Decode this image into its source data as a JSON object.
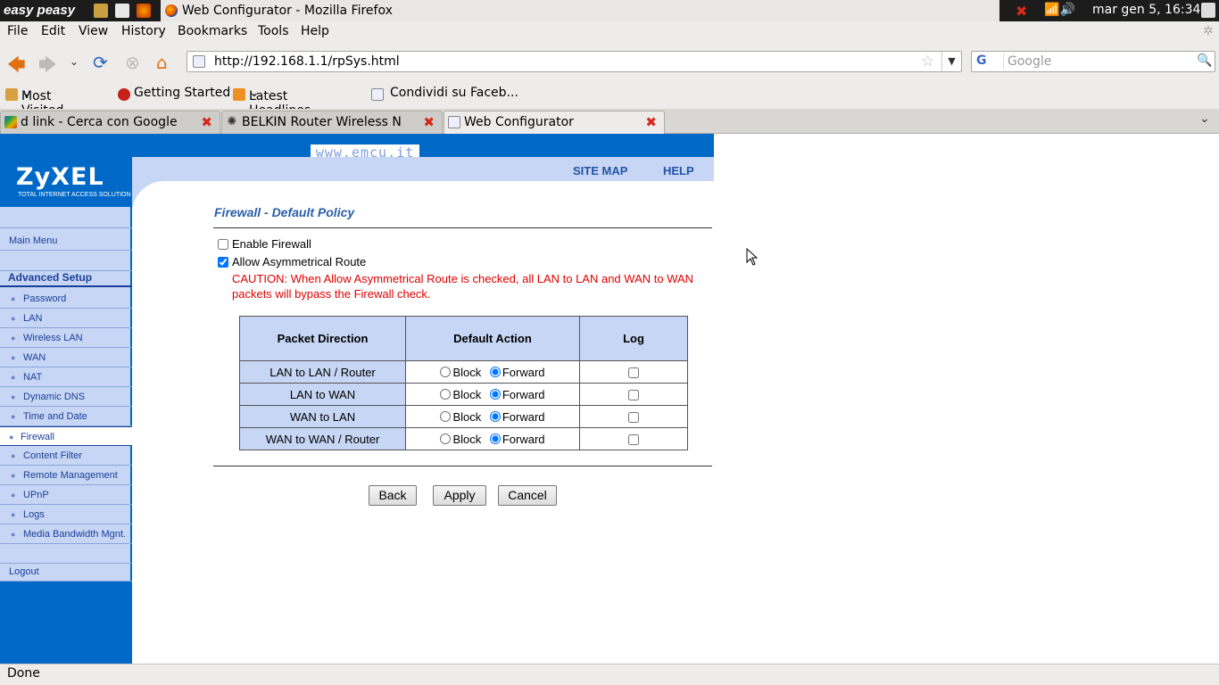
{
  "panel": {
    "logo": "easy peasy",
    "window_title": "Web Configurator - Mozilla Firefox",
    "clock": "mar gen  5, 16:34"
  },
  "menubar": [
    "File",
    "Edit",
    "View",
    "History",
    "Bookmarks",
    "Tools",
    "Help"
  ],
  "nav": {
    "url": "http://192.168.1.1/rpSys.html",
    "search_placeholder": "Google",
    "search_engine": "G"
  },
  "bookmarks": [
    "Most Visited",
    "Getting Started",
    "Latest Headlines",
    "Condividi su Faceb..."
  ],
  "tabs": [
    {
      "label": "d link - Cerca con Google"
    },
    {
      "label": "BELKIN Router Wireless N"
    },
    {
      "label": "Web Configurator"
    }
  ],
  "zyxel": {
    "logo": "ZyXEL",
    "logo_sub": "TOTAL INTERNET ACCESS SOLUTION",
    "watermark": "www.emcu.it",
    "site_map": "SITE MAP",
    "help": "HELP"
  },
  "sidebar": {
    "main_menu": "Main Menu",
    "advanced_setup": "Advanced Setup",
    "items": [
      "Password",
      "LAN",
      "Wireless LAN",
      "WAN",
      "NAT",
      "Dynamic DNS",
      "Time and Date",
      "Firewall",
      "Content Filter",
      "Remote Management",
      "UPnP",
      "Logs",
      "Media Bandwidth Mgnt."
    ],
    "logout": "Logout"
  },
  "content": {
    "title": "Firewall - Default Policy",
    "enable_firewall": "Enable Firewall",
    "allow_asym": "Allow Asymmetrical Route",
    "caution": "CAUTION: When Allow Asymmetrical Route is checked, all LAN to LAN and WAN to WAN packets will bypass the Firewall check.",
    "table": {
      "headers": [
        "Packet Direction",
        "Default Action",
        "Log"
      ],
      "block_label": "Block",
      "forward_label": "Forward",
      "rows": [
        {
          "direction": "LAN to LAN / Router"
        },
        {
          "direction": "LAN to WAN"
        },
        {
          "direction": "WAN to LAN"
        },
        {
          "direction": "WAN to WAN / Router"
        }
      ]
    },
    "buttons": {
      "back": "Back",
      "apply": "Apply",
      "cancel": "Cancel"
    }
  },
  "status": "Done"
}
